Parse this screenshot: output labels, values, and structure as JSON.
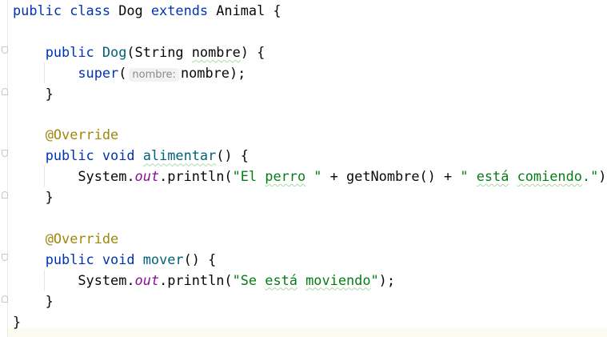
{
  "editor": {
    "lines": [
      {
        "tokens": [
          {
            "t": "public ",
            "c": "kw"
          },
          {
            "t": "class ",
            "c": "kw"
          },
          {
            "t": "Dog "
          },
          {
            "t": "extends ",
            "c": "kw"
          },
          {
            "t": "Animal {"
          }
        ]
      },
      {
        "tokens": []
      },
      {
        "tokens": [
          {
            "t": "    "
          },
          {
            "t": "public ",
            "c": "kw"
          },
          {
            "t": "Dog",
            "c": "fn"
          },
          {
            "t": "(String "
          },
          {
            "t": "nombre",
            "c": "typo"
          },
          {
            "t": ") {"
          }
        ]
      },
      {
        "tokens": [
          {
            "t": "        "
          },
          {
            "t": "super",
            "c": "kw"
          },
          {
            "t": "("
          },
          {
            "t": "nombre:",
            "c": "hint"
          },
          {
            "t": "nombre);"
          }
        ]
      },
      {
        "tokens": [
          {
            "t": "    }"
          }
        ]
      },
      {
        "tokens": []
      },
      {
        "tokens": [
          {
            "t": "    "
          },
          {
            "t": "@Override",
            "c": "ann"
          }
        ]
      },
      {
        "tokens": [
          {
            "t": "    "
          },
          {
            "t": "public ",
            "c": "kw"
          },
          {
            "t": "void ",
            "c": "kw"
          },
          {
            "t": "alimentar",
            "c": "fn typo"
          },
          {
            "t": "() {"
          }
        ]
      },
      {
        "tokens": [
          {
            "t": "        System."
          },
          {
            "t": "out",
            "c": "fld"
          },
          {
            "t": ".println("
          },
          {
            "t": "\"El ",
            "c": "str"
          },
          {
            "t": "perro",
            "c": "str typo"
          },
          {
            "t": " \"",
            "c": "str"
          },
          {
            "t": " + getNombre() + "
          },
          {
            "t": "\" ",
            "c": "str"
          },
          {
            "t": "está",
            "c": "str typo"
          },
          {
            "t": " ",
            "c": "str"
          },
          {
            "t": "comiendo",
            "c": "str typo"
          },
          {
            "t": ".\"",
            "c": "str"
          },
          {
            "t": ");"
          }
        ]
      },
      {
        "tokens": [
          {
            "t": "    }"
          }
        ]
      },
      {
        "tokens": []
      },
      {
        "tokens": [
          {
            "t": "    "
          },
          {
            "t": "@Override",
            "c": "ann"
          }
        ]
      },
      {
        "tokens": [
          {
            "t": "    "
          },
          {
            "t": "public ",
            "c": "kw"
          },
          {
            "t": "void ",
            "c": "kw"
          },
          {
            "t": "mover",
            "c": "fn"
          },
          {
            "t": "() {"
          }
        ]
      },
      {
        "tokens": [
          {
            "t": "        System."
          },
          {
            "t": "out",
            "c": "fld"
          },
          {
            "t": ".println("
          },
          {
            "t": "\"Se ",
            "c": "str"
          },
          {
            "t": "está",
            "c": "str typo"
          },
          {
            "t": " ",
            "c": "str"
          },
          {
            "t": "moviendo",
            "c": "str typo"
          },
          {
            "t": "\"",
            "c": "str"
          },
          {
            "t": ");"
          }
        ]
      },
      {
        "tokens": [
          {
            "t": "    }"
          }
        ]
      },
      {
        "tokens": [
          {
            "t": "}"
          }
        ]
      }
    ],
    "colors": {
      "keyword": "#0033b3",
      "method": "#00627a",
      "string": "#067d17",
      "annotation": "#9e880d",
      "field": "#871094"
    },
    "fold_markers": [
      {
        "line": 2,
        "kind": "open"
      },
      {
        "line": 4,
        "kind": "close"
      },
      {
        "line": 7,
        "kind": "open"
      },
      {
        "line": 9,
        "kind": "close"
      },
      {
        "line": 12,
        "kind": "open"
      },
      {
        "line": 14,
        "kind": "close"
      }
    ]
  }
}
